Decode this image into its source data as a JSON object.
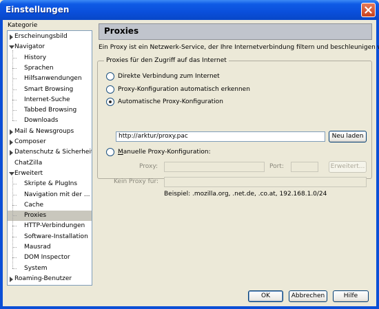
{
  "window": {
    "title": "Einstellungen"
  },
  "sidebar": {
    "label": "Kategorie",
    "items": [
      {
        "label": "Erscheinungsbild",
        "expander": "collapsed"
      },
      {
        "label": "Navigator",
        "expander": "expanded"
      },
      {
        "label": "History",
        "expander": "none"
      },
      {
        "label": "Sprachen",
        "expander": "none"
      },
      {
        "label": "Hilfsanwendungen",
        "expander": "none"
      },
      {
        "label": "Smart Browsing",
        "expander": "none"
      },
      {
        "label": "Internet-Suche",
        "expander": "none"
      },
      {
        "label": "Tabbed Browsing",
        "expander": "none"
      },
      {
        "label": "Downloads",
        "expander": "none"
      },
      {
        "label": "Mail & Newsgroups",
        "expander": "collapsed"
      },
      {
        "label": "Composer",
        "expander": "collapsed"
      },
      {
        "label": "Datenschutz & Sicherheit",
        "expander": "collapsed"
      },
      {
        "label": "ChatZilla",
        "expander": "none"
      },
      {
        "label": "Erweitert",
        "expander": "expanded"
      },
      {
        "label": "Skripte & PlugIns",
        "expander": "none"
      },
      {
        "label": "Navigation mit der ...",
        "expander": "none"
      },
      {
        "label": "Cache",
        "expander": "none"
      },
      {
        "label": "Proxies",
        "expander": "none",
        "selected": true
      },
      {
        "label": "HTTP-Verbindungen",
        "expander": "none"
      },
      {
        "label": "Software-Installation",
        "expander": "none"
      },
      {
        "label": "Mausrad",
        "expander": "none"
      },
      {
        "label": "DOM Inspector",
        "expander": "none"
      },
      {
        "label": "System",
        "expander": "none"
      },
      {
        "label": "Roaming-Benutzer",
        "expander": "collapsed"
      }
    ]
  },
  "panel": {
    "title": "Proxies",
    "description": "Ein Proxy ist ein Netzwerk-Service, der Ihre Internetverbindung filtern und beschleunigen will.",
    "group_label": "Proxies für den Zugriff auf das Internet",
    "options": {
      "direct": "Direkte Verbindung zum Internet",
      "auto_detect": "Proxy-Konfiguration automatisch erkennen",
      "auto_config": "Automatische Proxy-Konfiguration",
      "manual": "Manuelle Proxy-Konfiguration:"
    },
    "selected_option": "auto_config",
    "auto_config_url": "http://arktur/proxy.pac",
    "reload_button": "Neu laden",
    "proxy_label": "Proxy:",
    "proxy_value": "",
    "port_label": "Port:",
    "port_value": "",
    "advanced_button": "Erweitert...",
    "no_proxy_label": "Kein Proxy für:",
    "no_proxy_value": "",
    "example": "Beispiel: .mozilla.org, .net.de, .co.at, 192.168.1.0/24"
  },
  "footer": {
    "ok": "OK",
    "cancel": "Abbrechen",
    "help": "Hilfe"
  }
}
